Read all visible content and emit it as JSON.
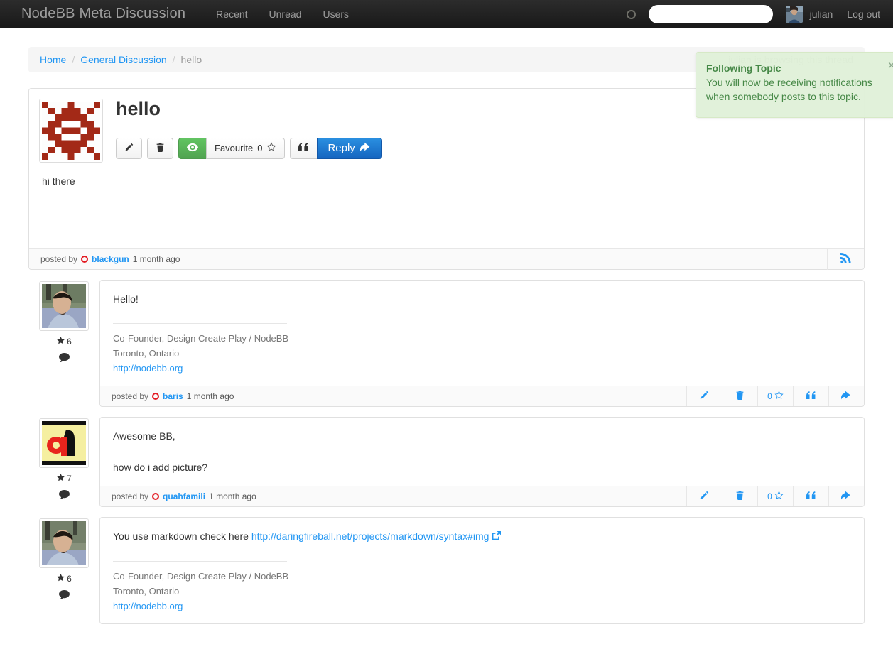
{
  "navbar": {
    "brand": "NodeBB Meta Discussion",
    "links": [
      {
        "label": "Recent"
      },
      {
        "label": "Unread"
      },
      {
        "label": "Users"
      }
    ],
    "notification_icon": "circle-icon",
    "search": {
      "value": "",
      "placeholder": ""
    },
    "user": {
      "name": "julian",
      "avatar_alt": "julian-avatar"
    },
    "logout_label": "Log out"
  },
  "breadcrumb": {
    "home": "Home",
    "category": "General Discussion",
    "current": "hello",
    "separator": "/",
    "browsing_text": "julian is browsing this thread"
  },
  "toast": {
    "title": "Following Topic",
    "body": "You will now be receiving notifications when somebody posts to this topic.",
    "close_label": "×"
  },
  "topic": {
    "title": "hello",
    "body": "hi there",
    "buttons": {
      "edit": "edit-icon",
      "delete": "trash-icon",
      "follow": "eye-icon",
      "favourite_label": "Favourite",
      "favourite_count": "0",
      "favourite_icon": "star-icon",
      "quote": "quote-icon",
      "reply_label": "Reply"
    },
    "footer": {
      "posted_by": "posted by",
      "author": "blackgun",
      "time": "1 month ago",
      "rss_icon": "rss-icon"
    }
  },
  "replies": [
    {
      "author": "baris",
      "posted_by": "posted by",
      "time": "1 month ago",
      "reputation": "6",
      "avatar_alt": "baris-avatar",
      "paragraphs": [
        "Hello!"
      ],
      "signature": {
        "line1": "Co-Founder, Design Create Play / NodeBB",
        "line2": "Toronto, Ontario",
        "link": "http://nodebb.org"
      },
      "actions": {
        "edit": "edit-icon",
        "delete": "trash-icon",
        "favourite_count": "0",
        "favourite_icon": "star-icon",
        "quote": "quote-icon",
        "reply": "reply-icon"
      }
    },
    {
      "author": "quahfamili",
      "posted_by": "posted by",
      "time": "1 month ago",
      "reputation": "7",
      "avatar_alt": "quahfamili-avatar",
      "paragraphs": [
        "Awesome BB,",
        "how do i add picture?"
      ],
      "signature": null,
      "actions": {
        "edit": "edit-icon",
        "delete": "trash-icon",
        "favourite_count": "0",
        "favourite_icon": "star-icon",
        "quote": "quote-icon",
        "reply": "reply-icon"
      }
    },
    {
      "author": "",
      "posted_by": "",
      "time": "",
      "reputation": "6",
      "avatar_alt": "psychobunny-avatar",
      "text_before_link": "You use markdown check here ",
      "link_text": "http://daringfireball.net/projects/markdown/syntax#img",
      "external_icon": "external-link-icon",
      "signature": {
        "line1": "Co-Founder, Design Create Play / NodeBB",
        "line2": "Toronto, Ontario",
        "link": "http://nodebb.org"
      }
    }
  ],
  "colors": {
    "navbar_bg": "#1f1f1f",
    "link_blue": "#2196f3",
    "primary_blue": "#1565c0",
    "success_green": "#51a351",
    "toast_bg": "#dff0d8",
    "toast_text": "#468847",
    "status_red": "#e31b23",
    "avatar_red": "#a32917"
  }
}
